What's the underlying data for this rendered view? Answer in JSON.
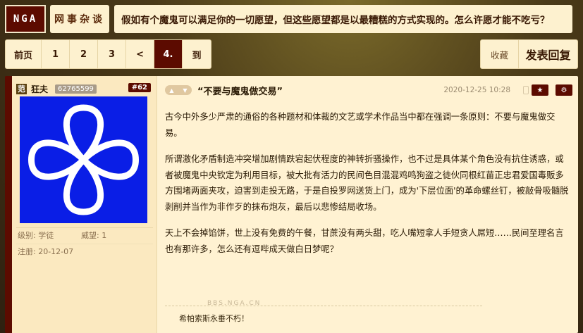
{
  "header": {
    "logo": "NGA",
    "forum": "网事杂谈",
    "topic_title": "假如有个魔鬼可以满足你的一切愿望，但这些愿望都是以最糟糕的方式实现的。怎么许愿才能不吃亏？"
  },
  "pagination": {
    "items": [
      {
        "label": "前页",
        "current": false
      },
      {
        "label": "1",
        "current": false
      },
      {
        "label": "2",
        "current": false
      },
      {
        "label": "3",
        "current": false
      },
      {
        "label": "<",
        "current": false
      },
      {
        "label": "4.",
        "current": true
      },
      {
        "label": "到",
        "current": false
      }
    ]
  },
  "actions": {
    "favorite": "收藏",
    "reply": "发表回复"
  },
  "post": {
    "user": {
      "badge": "范",
      "name": "狂夫",
      "uid": "62765599",
      "level_label": "级别:",
      "level": "学徒",
      "prestige_label": "威望:",
      "prestige": "1",
      "registered_label": "注册:",
      "registered": "20-12-07",
      "avatar_icon": "four-petal-loop-avatar"
    },
    "floor": "#62",
    "subject": "“不要与魔鬼做交易”",
    "date": "2020-12-25 10:28",
    "paragraphs": [
      "古今中外多少严肃的通俗的各种题材和体裁的文艺或学术作品当中都在强调一条原则：不要与魔鬼做交易。",
      "所谓激化矛盾制造冲突增加剧情跌宕起伏程度的神转折骚操作，也不过是具体某个角色没有抗住诱惑，或者被魔鬼中央钦定为利用目标，被大批有活力的民间色目混混鸡鸣狗盗之徒伙同根红苗正忠君爱国毒贩多方围堵两面夹攻，迫害到走投无路，于是自投罗网送货上门，成为'下层位面'的革命螺丝钉，被敲骨吸髓脱剥削并当作为非作歹的抹布炮灰，最后以悲惨结局收场。",
      "天上不会掉馅饼，世上没有免费的午餐，甘蔗没有两头甜，吃人嘴短拿人手短贪人屌短……民间至理名言也有那许多，怎么还有逗哔成天做白日梦呢？"
    ],
    "watermark": "BBS.NGA.CN",
    "signature": "希帕索斯永垂不朽！"
  },
  "colors": {
    "brand": "#5c0b00",
    "panel": "#fdf1cf",
    "avatar_bg": "#0a1ee6"
  }
}
